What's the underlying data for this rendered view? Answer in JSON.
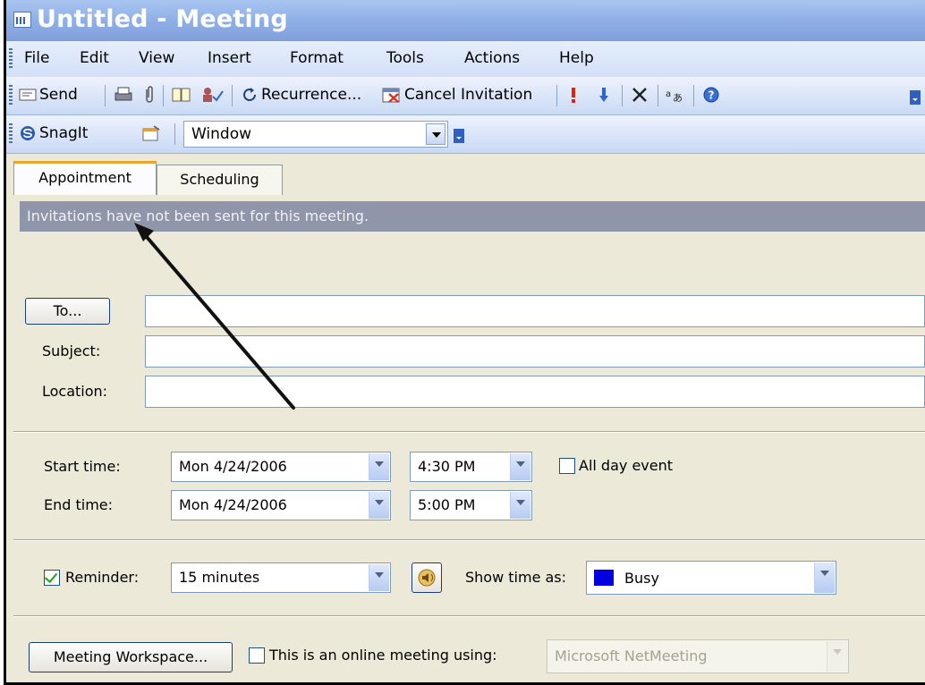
{
  "window": {
    "title": "Untitled - Meeting"
  },
  "menu": [
    {
      "label": "File"
    },
    {
      "label": "Edit"
    },
    {
      "label": "View"
    },
    {
      "label": "Insert"
    },
    {
      "label": "Format"
    },
    {
      "label": "Tools"
    },
    {
      "label": "Actions"
    },
    {
      "label": "Help"
    }
  ],
  "toolbar": {
    "send": "Send",
    "recurrence": "Recurrence...",
    "cancel_invitation": "Cancel Invitation",
    "snagit": "SnagIt",
    "snagit_dropdown": "Window"
  },
  "tabs": [
    {
      "label": "Appointment"
    },
    {
      "label": "Scheduling"
    }
  ],
  "info": "Invitations have not been sent for this meeting.",
  "form": {
    "to_button": "To...",
    "to_value": "",
    "subject_label": "Subject:",
    "subject_value": "",
    "location_label": "Location:",
    "location_value": "",
    "start_label": "Start time:",
    "start_date": "Mon 4/24/2006",
    "start_time": "4:30 PM",
    "all_day_label": "All day event",
    "end_label": "End time:",
    "end_date": "Mon 4/24/2006",
    "end_time": "5:00 PM",
    "reminder_label": "Reminder:",
    "reminder_value": "15 minutes",
    "show_time_label": "Show time as:",
    "show_time_value": "Busy",
    "workspace_button": "Meeting Workspace...",
    "online_label": "This is an online meeting using:",
    "online_value": "Microsoft NetMeeting"
  },
  "colors": {
    "busy": "#0000e0",
    "accent_tab": "#e8a530"
  }
}
